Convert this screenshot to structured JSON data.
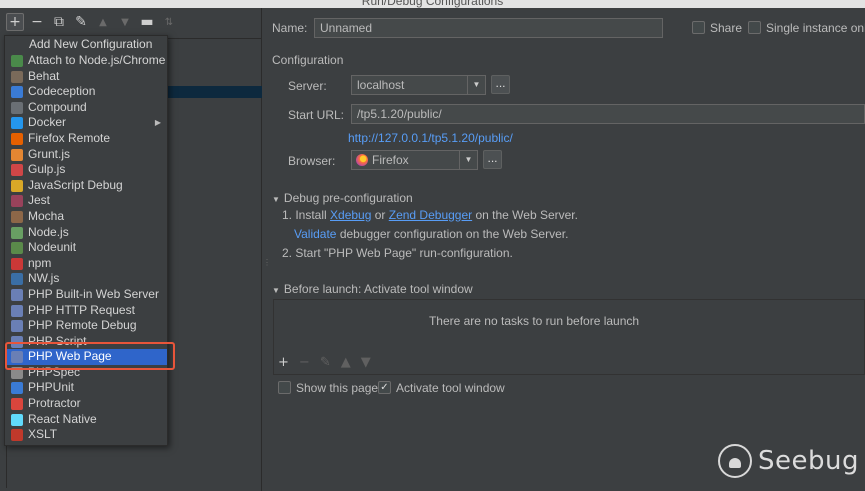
{
  "window": {
    "title": "Run/Debug Configurations"
  },
  "left_toolbar": {
    "add_icon": "plus-icon",
    "remove_icon": "minus-icon",
    "copy_icon": "copy-icon",
    "settings_icon": "wrench-icon",
    "up_icon": "arrow-up-icon",
    "down_icon": "arrow-down-icon",
    "folder_icon": "folder-icon",
    "sort_icon": "sort-icon"
  },
  "add_menu": {
    "title": "Add New Configuration",
    "items": [
      {
        "label": "Attach to Node.js/Chrome",
        "icon": "attach-icon",
        "color": "#4a8a4a"
      },
      {
        "label": "Behat",
        "icon": "behat-icon",
        "color": "#7a6a5a"
      },
      {
        "label": "Codeception",
        "icon": "codeception-icon",
        "color": "#3a7bd5"
      },
      {
        "label": "Compound",
        "icon": "compound-icon",
        "color": "#6a6f74"
      },
      {
        "label": "Docker",
        "icon": "docker-icon",
        "color": "#2496ed"
      },
      {
        "label": "Firefox Remote",
        "icon": "firefox-icon",
        "color": "#e66000"
      },
      {
        "label": "Grunt.js",
        "icon": "grunt-icon",
        "color": "#e48632"
      },
      {
        "label": "Gulp.js",
        "icon": "gulp-icon",
        "color": "#cf4647"
      },
      {
        "label": "JavaScript Debug",
        "icon": "js-debug-icon",
        "color": "#d9a827"
      },
      {
        "label": "Jest",
        "icon": "jest-icon",
        "color": "#99425b"
      },
      {
        "label": "Mocha",
        "icon": "mocha-icon",
        "color": "#8d6748"
      },
      {
        "label": "Node.js",
        "icon": "nodejs-icon",
        "color": "#689f63"
      },
      {
        "label": "Nodeunit",
        "icon": "nodeunit-icon",
        "color": "#5a8a4a"
      },
      {
        "label": "npm",
        "icon": "npm-icon",
        "color": "#cb3837"
      },
      {
        "label": "NW.js",
        "icon": "nwjs-icon",
        "color": "#3a6ea5"
      },
      {
        "label": "PHP Built-in Web Server",
        "icon": "php-server-icon",
        "color": "#6a7fb5"
      },
      {
        "label": "PHP HTTP Request",
        "icon": "php-http-icon",
        "color": "#6a7fb5"
      },
      {
        "label": "PHP Remote Debug",
        "icon": "php-remote-icon",
        "color": "#6a7fb5"
      },
      {
        "label": "PHP Script",
        "icon": "php-script-icon",
        "color": "#6a7fb5"
      },
      {
        "label": "PHP Web Page",
        "icon": "php-web-page-icon",
        "color": "#6a7fb5"
      },
      {
        "label": "PHPSpec",
        "icon": "phpspec-icon",
        "color": "#8a8a8a"
      },
      {
        "label": "PHPUnit",
        "icon": "phpunit-icon",
        "color": "#3a7bd5"
      },
      {
        "label": "Protractor",
        "icon": "protractor-icon",
        "color": "#d9453c"
      },
      {
        "label": "React Native",
        "icon": "react-icon",
        "color": "#61dafb"
      },
      {
        "label": "XSLT",
        "icon": "xslt-icon",
        "color": "#c0392b"
      }
    ],
    "selected_index": 19,
    "docker_submenu_arrow": "▶"
  },
  "form": {
    "name_label": "Name:",
    "name_value": "Unnamed",
    "share_label": "Share",
    "single_instance_label": "Single instance only",
    "configuration_label": "Configuration",
    "server_label": "Server:",
    "server_value": "localhost",
    "start_url_label": "Start URL:",
    "start_url_value": "/tp5.1.20/public/",
    "resolved_url": "http://127.0.0.1/tp5.1.20/public/",
    "browser_label": "Browser:",
    "browser_value": "Firefox",
    "browse_button": "...",
    "debug_section": "Debug pre-configuration",
    "step1_prefix": "1. Install ",
    "xdebug": "Xdebug",
    "or": " or ",
    "zend": "Zend Debugger",
    "step1_suffix": " on the Web Server.",
    "validate": "Validate",
    "validate_suffix": " debugger configuration on the Web Server.",
    "step2": "2. Start \"PHP Web Page\" run-configuration.",
    "before_launch": "Before launch: Activate tool window",
    "no_tasks": "There are no tasks to run before launch",
    "show_page_label": "Show this page",
    "activate_tool_label": "Activate tool window"
  },
  "watermark": {
    "text": "Seebug"
  }
}
